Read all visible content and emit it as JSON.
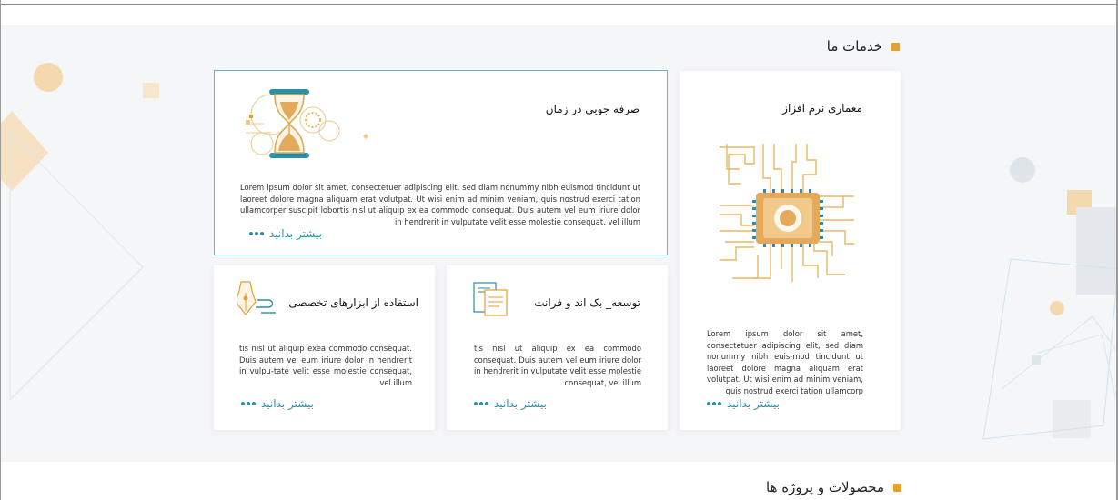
{
  "sections": {
    "services_title": "خدمات ما",
    "products_title": "محصولات و پروژه ها"
  },
  "colors": {
    "accent": "#e3a12f",
    "link": "#2a8fa8",
    "highlight_border": "#5db6cf",
    "section_bg": "#f5f6f8"
  },
  "cards": [
    {
      "title": "معماری نرم افزاز",
      "icon": "circuit-chip-icon",
      "text": "Lorem ipsum dolor sit amet, consectetuer adipiscing elit, sed diam nonummy nibh euis-mod tincidunt ut laoreet dolore magna aliquam erat volutpat. Ut wisi enim ad minim veniam, quis nostrud exerci tation ullamcorp",
      "more": "بیشتر بدانید"
    },
    {
      "title": "صرفه جویی در زمان",
      "icon": "hourglass-icon",
      "text": "Lorem ipsum dolor sit amet, consectetuer adipiscing elit, sed diam nonummy nibh euismod tincidunt ut laoreet dolore magna aliquam erat volutpat. Ut wisi enim ad minim veniam, quis nostrud exerci tation ullamcorper suscipit lobortis nisl ut aliquip ex ea commodo consequat. Duis autem vel eum iriure dolor in hendrerit in vulputate velit esse molestie consequat, vel illum",
      "more": "بیشتر بدانید"
    },
    {
      "title": "توسعه_ بک اند و فرانت",
      "icon": "documents-icon",
      "text": "tis nisl ut aliquip ex ea commodo consequat. Duis autem vel eum iriure dolor in hendrerit in vulputate velit esse molestie consequat, vel illum",
      "more": "بیشتر بدانید"
    },
    {
      "title": "استفاده از ابزارهای تخصصی",
      "icon": "pen-nib-icon",
      "text": "tis nisl ut aliquip exea commodo consequat. Duis autem vel eum iriure dolor in hendrerit in vulpu-tate velit esse molestie consequat, vel illum",
      "more": "بیشتر بدانید"
    }
  ]
}
